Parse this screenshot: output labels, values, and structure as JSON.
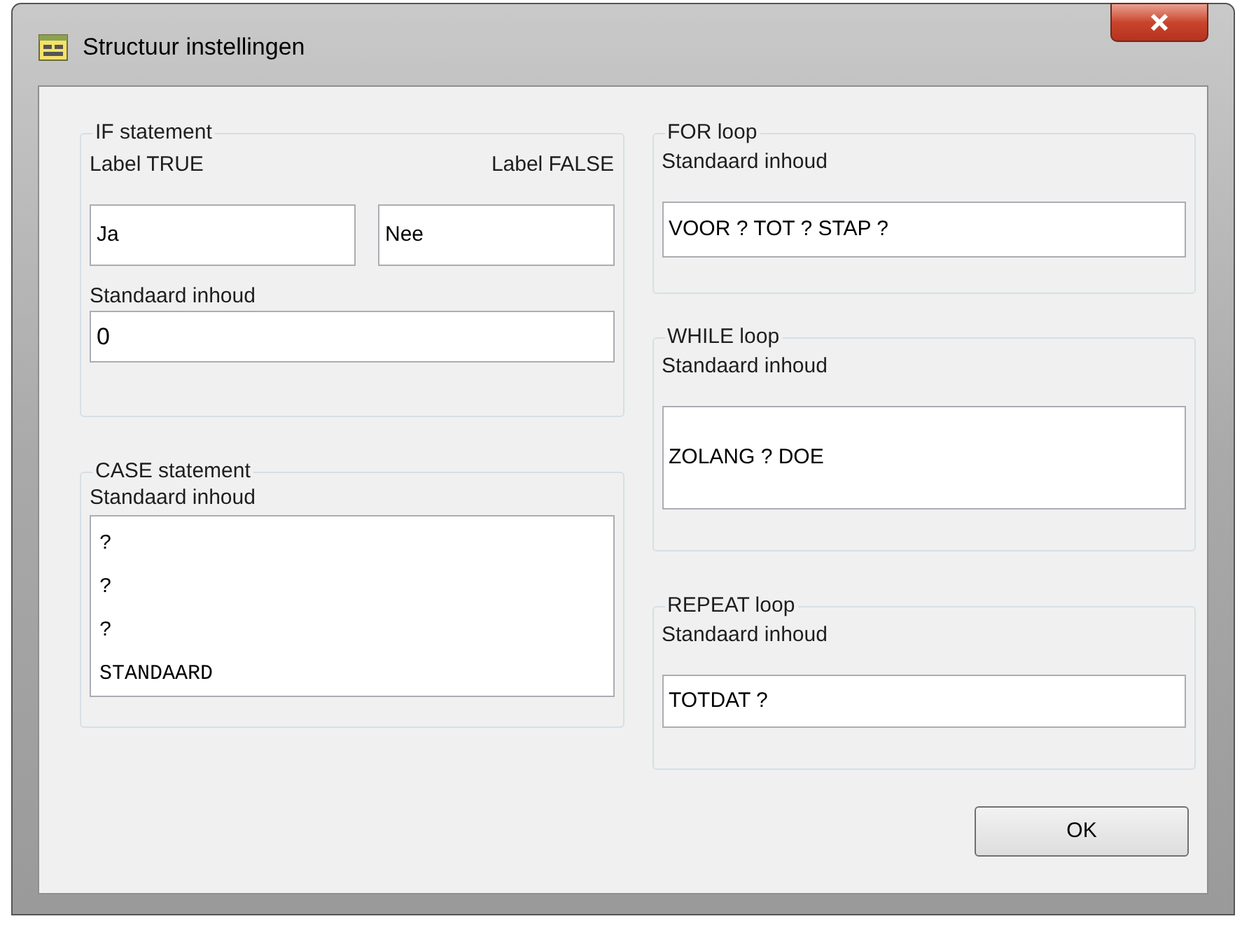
{
  "window": {
    "title": "Structuur instellingen"
  },
  "if_statement": {
    "title": "IF statement",
    "label_true": {
      "label": "Label TRUE",
      "value": "Ja"
    },
    "label_false": {
      "label": "Label FALSE",
      "value": "Nee"
    },
    "default_content": {
      "label": "Standaard inhoud",
      "value": "0"
    }
  },
  "case_statement": {
    "title": "CASE statement",
    "default_content": {
      "label": "Standaard inhoud",
      "lines": [
        "?",
        "?",
        "?",
        "STANDAARD"
      ]
    }
  },
  "for_loop": {
    "title": "FOR loop",
    "default_content": {
      "label": "Standaard inhoud",
      "value": "VOOR ? TOT ? STAP ?"
    }
  },
  "while_loop": {
    "title": "WHILE loop",
    "default_content": {
      "label": "Standaard inhoud",
      "value": "ZOLANG ? DOE"
    }
  },
  "repeat_loop": {
    "title": "REPEAT loop",
    "default_content": {
      "label": "Standaard inhoud",
      "value": "TOTDAT ?"
    }
  },
  "buttons": [
    {
      "label": "OK"
    }
  ]
}
